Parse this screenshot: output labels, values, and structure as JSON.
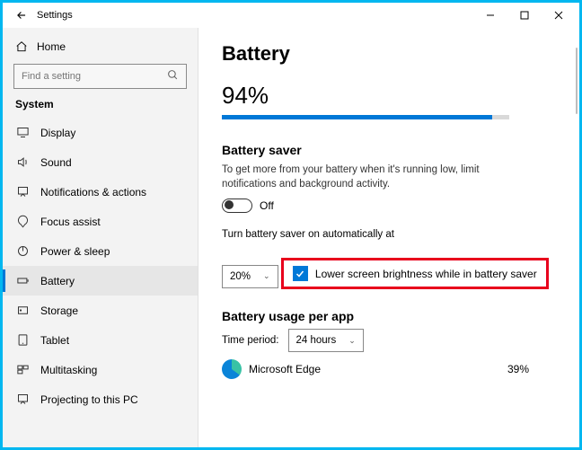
{
  "window": {
    "title": "Settings"
  },
  "sidebar": {
    "home": "Home",
    "search_placeholder": "Find a setting",
    "section": "System",
    "items": [
      {
        "label": "Display"
      },
      {
        "label": "Sound"
      },
      {
        "label": "Notifications & actions"
      },
      {
        "label": "Focus assist"
      },
      {
        "label": "Power & sleep"
      },
      {
        "label": "Battery"
      },
      {
        "label": "Storage"
      },
      {
        "label": "Tablet"
      },
      {
        "label": "Multitasking"
      },
      {
        "label": "Projecting to this PC"
      }
    ]
  },
  "page": {
    "title": "Battery",
    "percent_text": "94%",
    "percent_value": 94,
    "saver_heading": "Battery saver",
    "saver_desc": "To get more from your battery when it's running low, limit notifications and background activity.",
    "toggle_state": "Off",
    "auto_label": "Turn battery saver on automatically at",
    "auto_value": "20%",
    "lower_brightness": "Lower screen brightness while in battery saver",
    "usage_heading": "Battery usage per app",
    "time_period_label": "Time period:",
    "time_period_value": "24 hours",
    "apps": [
      {
        "name": "Microsoft Edge",
        "pct": "39%"
      }
    ]
  }
}
